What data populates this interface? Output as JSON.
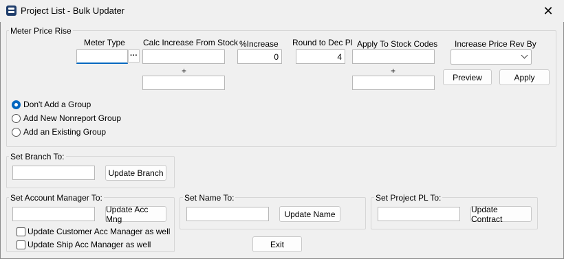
{
  "window": {
    "title": "Project List - Bulk Updater",
    "close_glyph": "✕"
  },
  "meter": {
    "legend": "Meter Price Rise",
    "meter_type_label": "Meter Type",
    "meter_type_value": "",
    "ellipsis": "···",
    "calc_from_label": "Calc Increase From Stock",
    "calc_from_value": "",
    "plus1": "+",
    "calc_from_value2": "",
    "pct_label": "%Increase",
    "pct_value": "0",
    "round_label": "Round to Dec Pl",
    "round_value": "4",
    "apply_codes_label": "Apply To Stock Codes",
    "apply_codes_value": "",
    "plus2": "+",
    "apply_codes_value2": "",
    "rev_by_label": "Increase Price Rev By",
    "rev_by_value": "",
    "preview_label": "Preview",
    "apply_label": "Apply",
    "radios": [
      {
        "label": "Don't Add a Group",
        "checked": true
      },
      {
        "label": "Add New Nonreport Group",
        "checked": false
      },
      {
        "label": "Add an Existing Group",
        "checked": false
      }
    ]
  },
  "branch": {
    "legend": "Set Branch To:",
    "value": "",
    "button": "Update Branch"
  },
  "accmgr": {
    "legend": "Set Account Manager To:",
    "value": "",
    "button": "Update Acc Mng",
    "check1": "Update Customer Acc Manager as well",
    "check2": "Update Ship Acc Manager as well"
  },
  "name": {
    "legend": "Set Name To:",
    "value": "",
    "button": "Update Name"
  },
  "projpl": {
    "legend": "Set Project PL To:",
    "value": "",
    "button": "Update Contract"
  },
  "exit_label": "Exit"
}
